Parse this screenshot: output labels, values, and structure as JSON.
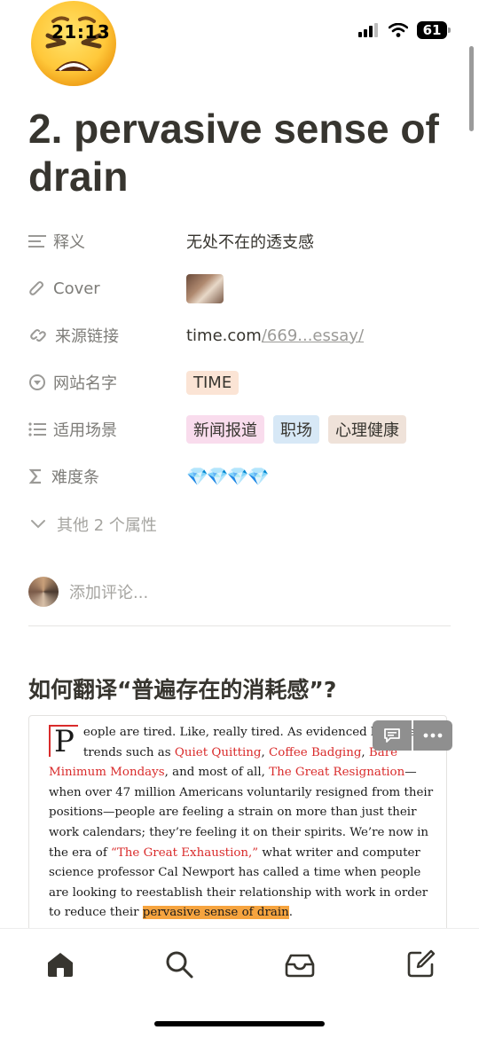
{
  "status": {
    "time": "21:13",
    "battery": "61"
  },
  "page": {
    "emoji": "😩",
    "title": "2. pervasive sense of drain"
  },
  "properties": [
    {
      "key": "释义",
      "icon": "text-lines-icon",
      "value": "无处不在的透支感"
    },
    {
      "key": "Cover",
      "icon": "paperclip-icon",
      "value_type": "image"
    },
    {
      "key": "来源链接",
      "icon": "link-icon",
      "link_host": "time.com",
      "link_rest": "/669...essay/"
    },
    {
      "key": "网站名字",
      "icon": "circle-chevron-icon",
      "tags": [
        {
          "label": "TIME",
          "color": "#fbe4d5"
        }
      ]
    },
    {
      "key": "适用场景",
      "icon": "list-icon",
      "tags": [
        {
          "label": "新闻报道",
          "color": "#f9dced"
        },
        {
          "label": "职场",
          "color": "#d7e8f6"
        },
        {
          "label": "心理健康",
          "color": "#efe2d9"
        }
      ]
    },
    {
      "key": "难度条",
      "icon": "sigma-icon",
      "value": "💎💎💎💎"
    }
  ],
  "more_properties": "其他 2 个属性",
  "comment_placeholder": "添加评论...",
  "section_heading": "如何翻译“普遍存在的消耗感”?",
  "quote": {
    "dropcap": "P",
    "t1": "eople are tired. Like, really tired. As evidenced by recent trends such as ",
    "r1": "Quiet Quitting",
    "t2": ", ",
    "r2": "Coffee Badging",
    "t3": ", ",
    "r3": "Bare Minimum Mondays",
    "t4": ", and most of all, ",
    "r4": "The Great Resignation",
    "t5": "—when over 47 million Americans voluntarily resigned from their positions—people are feeling a strain on more than just their work calendars; they’re feeling it on their spirits. We’re now in the era of ",
    "r5": "“The Great Exhaustion,”",
    "t6": " what writer and computer science professor Cal Newport has called a time when people are looking to reestablish their relationship with work in order to reduce their ",
    "highlight": "pervasive sense of drain",
    "t7": "."
  },
  "tabs": [
    "home-icon",
    "search-icon",
    "inbox-icon",
    "compose-icon"
  ],
  "colors": {
    "accent_red": "#d92b2b",
    "highlight": "#f6a43f"
  }
}
